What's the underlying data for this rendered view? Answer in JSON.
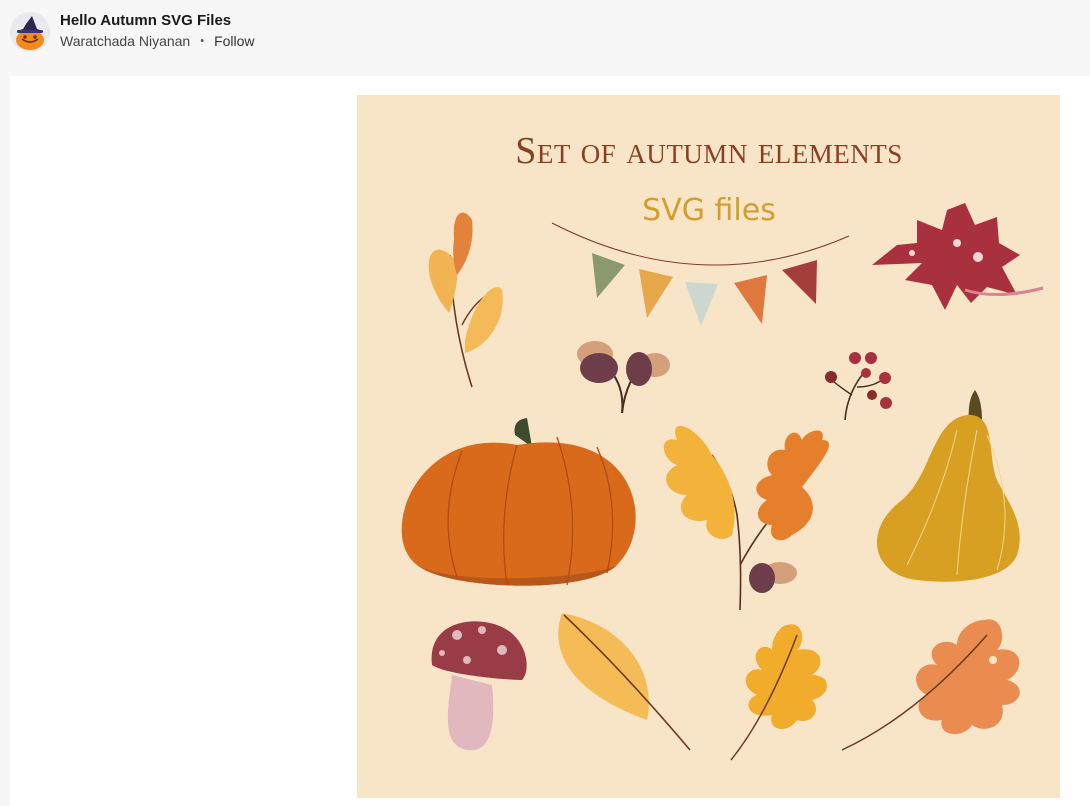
{
  "post": {
    "title": "Hello Autumn SVG Files",
    "author": "Waratchada Niyanan",
    "separator": "•",
    "follow_label": "Follow",
    "avatar_icon": "pumpkin-witch-avatar"
  },
  "artwork": {
    "heading": "Set of autumn elements",
    "subheading": "SVG files",
    "background_color": "#f8e5c8",
    "heading_color": "#8b3f22",
    "subheading_color": "#d29f2c"
  }
}
